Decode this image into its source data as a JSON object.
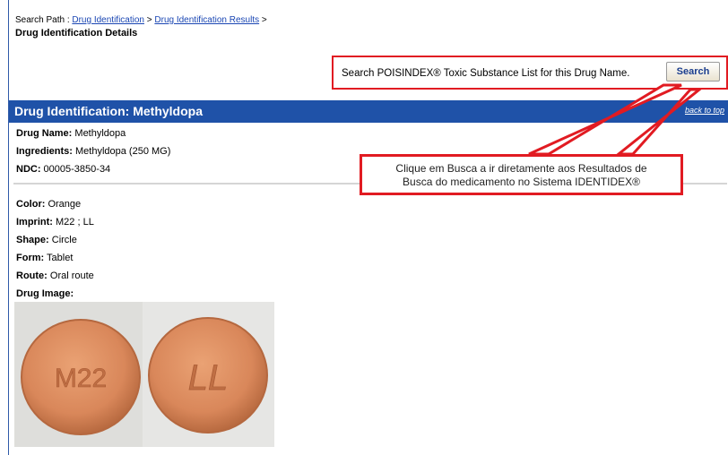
{
  "breadcrumb": {
    "prefix": "Search Path : ",
    "link1": "Drug Identification",
    "sep1": " > ",
    "link2": "Drug Identification Results",
    "sep2": " >"
  },
  "page_title": "Drug Identification Details",
  "search": {
    "text": "Search POISINDEX® Toxic Substance List for this Drug Name.",
    "button": "Search"
  },
  "section": {
    "title": "Drug Identification: Methyldopa",
    "back_link": "back to top"
  },
  "drug": {
    "name_label": "Drug Name:",
    "name_value": " Methyldopa",
    "ingredients_label": "Ingredients:",
    "ingredients_value": " Methyldopa (250 MG)",
    "ndc_label": "NDC:",
    "ndc_value": " 00005-3850-34",
    "color_label": "Color:",
    "color_value": " Orange",
    "imprint_label": "Imprint:",
    "imprint_value": " M22 ; LL",
    "shape_label": "Shape:",
    "shape_value": " Circle",
    "form_label": "Form:",
    "form_value": " Tablet",
    "route_label": "Route:",
    "route_value": " Oral route",
    "image_label": "Drug Image:"
  },
  "callout": {
    "line1": "Clique em Busca a ir diretamente aos Resultados de",
    "line2": "Busca do medicamento no Sistema IDENTIDEX®"
  },
  "pill": {
    "front_text": "M22",
    "back_text": "LL"
  },
  "colors": {
    "header_blue": "#1f52a8",
    "annotation_red": "#e11b22",
    "link_blue": "#1a46b3",
    "pill_orange": "#d9875a"
  }
}
